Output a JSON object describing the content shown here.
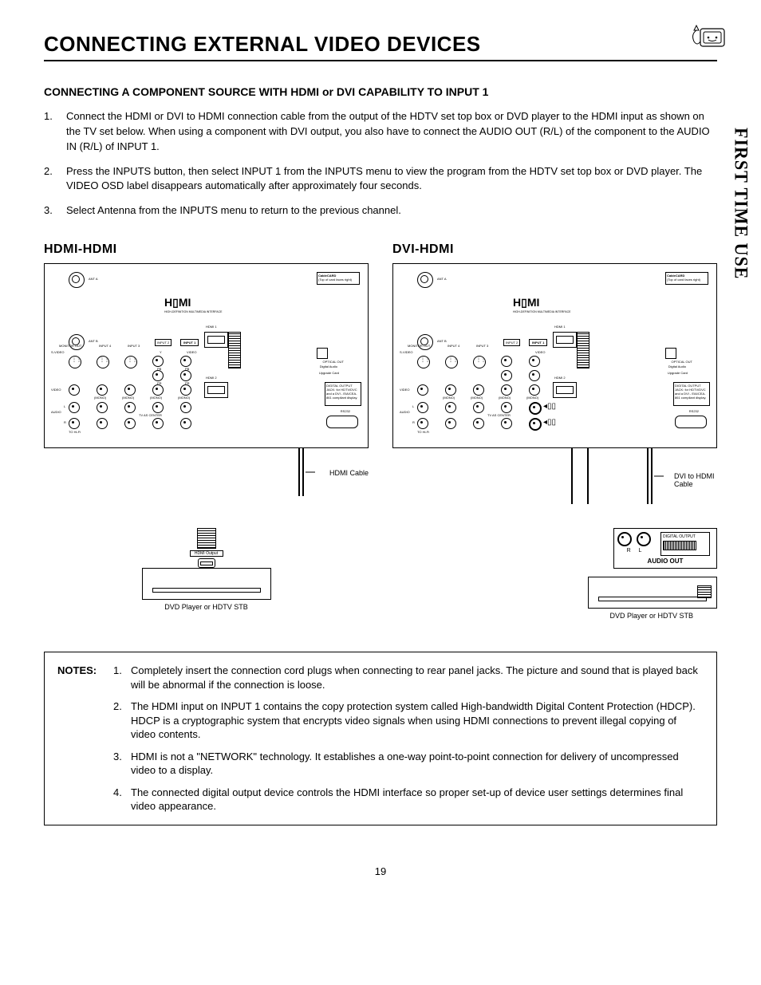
{
  "page": {
    "title": "CONNECTING EXTERNAL VIDEO DEVICES",
    "sidebar": "FIRST TIME USE",
    "page_number": "19",
    "subheading": "CONNECTING A COMPONENT SOURCE WITH HDMI or DVI CAPABILITY TO INPUT 1",
    "steps": [
      {
        "n": "1.",
        "t": "Connect the HDMI or DVI to HDMI connection cable from the output of the HDTV set top box or DVD player to the HDMI input as shown on the TV set below.  When using a component with DVI output, you also have to connect the AUDIO OUT (R/L) of the component to the AUDIO IN (R/L) of INPUT 1."
      },
      {
        "n": "2.",
        "t": "Press the INPUTS button, then select INPUT 1 from the INPUTS menu to view the program from the HDTV set top box or DVD player.  The VIDEO OSD label disappears automatically after approximately four seconds."
      },
      {
        "n": "3.",
        "t": "Select Antenna from the INPUTS menu to return to the previous channel."
      }
    ],
    "diagrams": {
      "left_label": "HDMI-HDMI",
      "right_label": "DVI-HDMI",
      "ant_a": "ANT A",
      "ant_b": "ANT B",
      "hdmi_logo": "HDMI",
      "hdmi1": "HDMI 1",
      "hdmi2": "HDMI 2",
      "input1": "INPUT 1",
      "input2": "INPUT 2",
      "input3": "INPUT 3",
      "input4": "INPUT 4",
      "monitor_out": "MONITOR OUT",
      "svideo": "S-VIDEO",
      "video": "VIDEO",
      "audio": "AUDIO",
      "pb": "PB",
      "pr": "PR",
      "y": "Y",
      "mono": "(MONO)",
      "tv_center": "TV AS CENTER",
      "cablecard": "CableCARD",
      "cablecard_note": "(Top of card faces right)",
      "optical": "OPTICAL OUT",
      "optical_sub": "Digital Audio",
      "upgrade": "Upgrade Card",
      "svc1": "DIGITAL OUTPUT JACK: for HDTV/DVC and a DVI - EIA/CEA-861 compliant display.",
      "rs232": "RS232",
      "to_hifi": "TO Hi-Fi",
      "r": "R",
      "l": "L",
      "hdmi_cable": "HDMI Cable",
      "dvi_cable": "DVI to HDMI Cable",
      "hdmi_output": "HDMI Output",
      "device": "DVD Player or HDTV STB",
      "audio_out": "AUDIO OUT",
      "digital_output": "DIGITAL OUTPUT"
    },
    "notes_head": "NOTES:",
    "notes": [
      {
        "n": "1.",
        "t": "Completely insert the connection cord plugs when connecting to rear panel jacks.  The picture and sound that is played back will be abnormal if the connection is loose."
      },
      {
        "n": "2.",
        "t": "The HDMI input on INPUT 1 contains the copy protection system called High-bandwidth Digital Content Protection (HDCP).  HDCP is a cryptographic system that encrypts video signals when using HDMI connections to prevent illegal copying of video contents."
      },
      {
        "n": "3.",
        "t": "HDMI is not a \"NETWORK\" technology.  It establishes a one-way point-to-point connection for delivery of uncompressed video to a display."
      },
      {
        "n": "4.",
        "t": "The connected digital output device controls the HDMI interface so proper set-up of device user settings determines final video appearance."
      }
    ]
  }
}
